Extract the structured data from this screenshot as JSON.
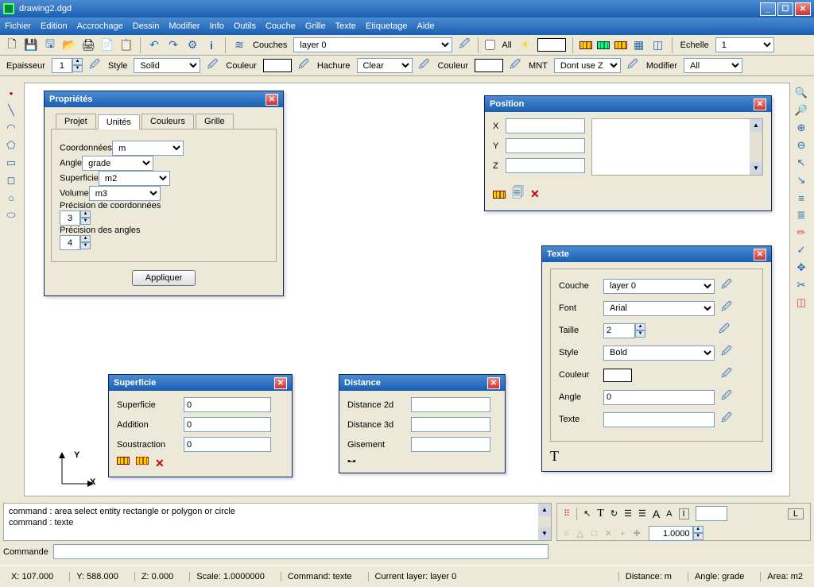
{
  "window": {
    "title": "drawing2.dgd"
  },
  "menu": [
    "Fichier",
    "Edition",
    "Accrochage",
    "Dessin",
    "Modifier",
    "Info",
    "Outils",
    "Couche",
    "Grille",
    "Texte",
    "Etiquetage",
    "Aide"
  ],
  "tb1": {
    "couches_label": "Couches",
    "layer_value": "layer 0",
    "all_label": "All",
    "echelle_label": "Echelle",
    "echelle_value": "1"
  },
  "tb2": {
    "epaisseur_label": "Epaisseur",
    "epaisseur_value": "1",
    "style_label": "Style",
    "style_value": "Solid",
    "couleur_label": "Couleur",
    "hachure_label": "Hachure",
    "hachure_value": "Clear",
    "couleur2_label": "Couleur",
    "mnt_label": "MNT",
    "mnt_value": "Dont use Z",
    "modifier_label": "Modifier",
    "modifier_value": "All"
  },
  "dlg_prop": {
    "title": "Propriétés",
    "tabs": [
      "Projet",
      "Unités",
      "Couleurs",
      "Grille"
    ],
    "rows": [
      {
        "label": "Coordonnées",
        "value": "m",
        "type": "select"
      },
      {
        "label": "Angle",
        "value": "grade",
        "type": "select"
      },
      {
        "label": "Superficie",
        "value": "m2",
        "type": "select"
      },
      {
        "label": "Volume",
        "value": "m3",
        "type": "select"
      },
      {
        "label": "Précision de coordonnées",
        "value": "3",
        "type": "spin"
      },
      {
        "label": "Précision des angles",
        "value": "4",
        "type": "spin"
      }
    ],
    "apply": "Appliquer"
  },
  "dlg_pos": {
    "title": "Position",
    "x_label": "X",
    "y_label": "Y",
    "z_label": "Z",
    "x": "",
    "y": "",
    "z": ""
  },
  "dlg_texte": {
    "title": "Texte",
    "rows": [
      {
        "label": "Couche",
        "value": "layer 0",
        "type": "select"
      },
      {
        "label": "Font",
        "value": "Arial",
        "type": "select"
      },
      {
        "label": "Taille",
        "value": "2",
        "type": "spin"
      },
      {
        "label": "Style",
        "value": "Bold",
        "type": "select"
      },
      {
        "label": "Couleur",
        "value": "",
        "type": "swatch"
      },
      {
        "label": "Angle",
        "value": "0",
        "type": "input"
      },
      {
        "label": "Texte",
        "value": "",
        "type": "input"
      }
    ]
  },
  "dlg_sup": {
    "title": "Superficie",
    "rows": [
      {
        "label": "Superficie",
        "value": "0"
      },
      {
        "label": "Addition",
        "value": "0"
      },
      {
        "label": "Soustraction",
        "value": "0"
      }
    ]
  },
  "dlg_dist": {
    "title": "Distance",
    "rows": [
      {
        "label": "Distance 2d",
        "value": ""
      },
      {
        "label": "Distance 3d",
        "value": ""
      },
      {
        "label": "Gisement",
        "value": ""
      }
    ]
  },
  "cmd": {
    "log1": "command : area   select entity rectangle or polygon or circle",
    "log2": "command : texte",
    "label": "Commande"
  },
  "br_bar": {
    "num": "1.0000",
    "btn_L": "L",
    "btn_I": "I"
  },
  "status": {
    "x": "X: 107.000",
    "y": "Y: 588.000",
    "z": "Z: 0.000",
    "scale": "Scale: 1.0000000",
    "cmd": "Command: texte",
    "layer": "Current layer: layer 0",
    "dist": "Distance: m",
    "angle": "Angle: grade",
    "area": "Area: m2"
  },
  "axes": {
    "y": "Y",
    "x": "X"
  }
}
